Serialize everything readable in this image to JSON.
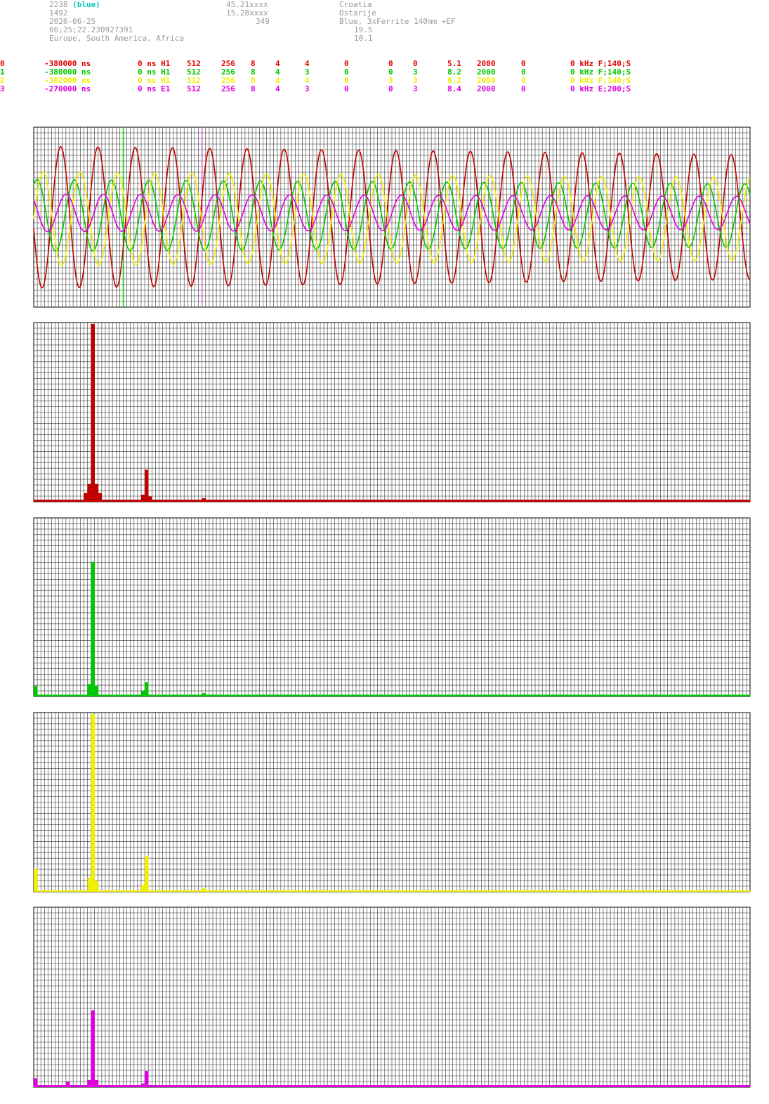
{
  "header": {
    "station_id": "2238",
    "station_tag": "(blue)",
    "station_num": "1492",
    "date": "2026-06-25",
    "time": "06;25;22.230927391",
    "regions": "Europe, South America, Africa",
    "latitude": "45.21xxxx",
    "longitude": "15.28xxxx",
    "altitude": "349",
    "country": "Croatia",
    "location": "Ostarije",
    "antenna": "Blue, 3xFerrite 140mm +EF",
    "value_a": "19.5",
    "value_b": "10.1"
  },
  "channels": [
    {
      "id": "0",
      "offset": "-380000 ns",
      "delay": "0 ns H1",
      "n1": "512",
      "n2": "256",
      "n3": "8",
      "n4": "4",
      "n5": "4",
      "n6": "0",
      "n7": "0",
      "n8": "0",
      "gain": "5.1",
      "rate": "2000",
      "n9": "0",
      "filter": "0 kHz F;140;S",
      "color": "#e00000"
    },
    {
      "id": "1",
      "offset": "-380000 ns",
      "delay": "0 ns H1",
      "n1": "512",
      "n2": "256",
      "n3": "8",
      "n4": "4",
      "n5": "3",
      "n6": "0",
      "n7": "0",
      "n8": "3",
      "gain": "8.2",
      "rate": "2000",
      "n9": "0",
      "filter": "0 kHz F;140;S",
      "color": "#00c800"
    },
    {
      "id": "2",
      "offset": "-302000 ns",
      "delay": "0 ns H1",
      "n1": "512",
      "n2": "256",
      "n3": "8",
      "n4": "4",
      "n5": "4",
      "n6": "0",
      "n7": "3",
      "n8": "3",
      "gain": "8.2",
      "rate": "2000",
      "n9": "0",
      "filter": "0 kHz F;140;S",
      "color": "#f0f000"
    },
    {
      "id": "3",
      "offset": "-270000 ns",
      "delay": "0 ns E1",
      "n1": "512",
      "n2": "256",
      "n3": "8",
      "n4": "4",
      "n5": "3",
      "n6": "0",
      "n7": "0",
      "n8": "3",
      "gain": "8.4",
      "rate": "2000",
      "n9": "0",
      "filter": "0 kHz E;200;S",
      "color": "#e000e0"
    }
  ],
  "chart_data": [
    {
      "type": "line",
      "panel": "waveform",
      "grid": true,
      "x_samples": 200,
      "ylim": [
        -1,
        1
      ],
      "markers": [
        {
          "x": 25,
          "color": "#00c800"
        },
        {
          "x": 47,
          "color": "#d060d0"
        }
      ],
      "series": [
        {
          "color": "#c00000",
          "amplitude": 0.83,
          "period": 10.4,
          "phase": 3.3,
          "offset": 0.0
        },
        {
          "color": "#00c800",
          "amplitude": 0.42,
          "period": 10.4,
          "phase": 1.0,
          "offset": 0.02
        },
        {
          "color": "#f0f000",
          "amplitude": 0.55,
          "period": 10.4,
          "phase": 0.0,
          "offset": -0.02
        },
        {
          "color": "#e000e0",
          "amplitude": 0.22,
          "period": 10.4,
          "phase": 2.4,
          "offset": 0.05
        }
      ]
    },
    {
      "type": "bar",
      "panel": "spectrum-ch0",
      "color": "#c00000",
      "grid": true,
      "ylim": [
        0,
        1
      ],
      "bins": 200,
      "peaks": [
        {
          "bin": 16,
          "value": 1.0
        },
        {
          "bin": 15,
          "value": 0.1
        },
        {
          "bin": 17,
          "value": 0.1
        },
        {
          "bin": 14,
          "value": 0.05
        },
        {
          "bin": 18,
          "value": 0.05
        },
        {
          "bin": 31,
          "value": 0.18
        },
        {
          "bin": 30,
          "value": 0.04
        },
        {
          "bin": 32,
          "value": 0.03
        },
        {
          "bin": 47,
          "value": 0.02
        }
      ],
      "floor": 0.012
    },
    {
      "type": "bar",
      "panel": "spectrum-ch1",
      "color": "#00c800",
      "grid": true,
      "ylim": [
        0,
        1
      ],
      "bins": 200,
      "peaks": [
        {
          "bin": 16,
          "value": 0.76
        },
        {
          "bin": 15,
          "value": 0.07
        },
        {
          "bin": 17,
          "value": 0.06
        },
        {
          "bin": 0,
          "value": 0.06
        },
        {
          "bin": 31,
          "value": 0.08
        },
        {
          "bin": 30,
          "value": 0.03
        },
        {
          "bin": 47,
          "value": 0.02
        }
      ],
      "floor": 0.01
    },
    {
      "type": "bar",
      "panel": "spectrum-ch2",
      "color": "#f0f000",
      "grid": true,
      "ylim": [
        0,
        1
      ],
      "bins": 200,
      "peaks": [
        {
          "bin": 16,
          "value": 1.0
        },
        {
          "bin": 15,
          "value": 0.08
        },
        {
          "bin": 17,
          "value": 0.06
        },
        {
          "bin": 0,
          "value": 0.13
        },
        {
          "bin": 31,
          "value": 0.2
        },
        {
          "bin": 30,
          "value": 0.04
        },
        {
          "bin": 47,
          "value": 0.02
        }
      ],
      "floor": 0.008
    },
    {
      "type": "bar",
      "panel": "spectrum-ch3",
      "color": "#e000e0",
      "grid": true,
      "ylim": [
        0,
        1
      ],
      "bins": 200,
      "peaks": [
        {
          "bin": 16,
          "value": 0.43
        },
        {
          "bin": 15,
          "value": 0.04
        },
        {
          "bin": 17,
          "value": 0.04
        },
        {
          "bin": 0,
          "value": 0.05
        },
        {
          "bin": 31,
          "value": 0.09
        },
        {
          "bin": 30,
          "value": 0.02
        },
        {
          "bin": 9,
          "value": 0.03
        }
      ],
      "floor": 0.012
    }
  ]
}
